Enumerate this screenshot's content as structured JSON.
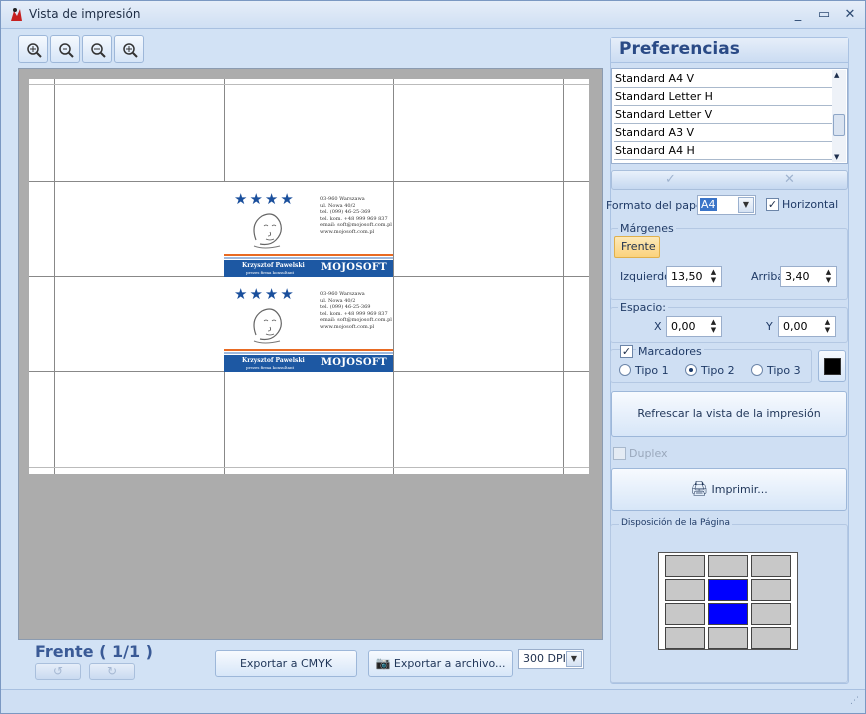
{
  "window": {
    "title": "Vista de impresión"
  },
  "toolbar": {
    "icons": [
      "zoom-fit-icon",
      "zoom-in-icon",
      "zoom-out-icon",
      "zoom-magnify-icon"
    ]
  },
  "preview": {
    "cards": [
      {
        "stars": "★★★★",
        "address": [
          "03-960 Warszawa",
          "ul. Nowa 40/2",
          "tel. (099) 46-25-369",
          "tel. kom. +48 999 969 837",
          "email: soft@mojosoft.com.pl",
          "www.mojosoft.com.pl"
        ],
        "name": "Krzysztof Pawelski",
        "job_title": "prezes firma konsultant",
        "brand": "MOJOSOFT"
      },
      {
        "stars": "★★★★",
        "address": [
          "03-960 Warszawa",
          "ul. Nowa 40/2",
          "tel. (099) 46-25-369",
          "tel. kom. +48 999 969 837",
          "email: soft@mojosoft.com.pl",
          "www.mojosoft.com.pl"
        ],
        "name": "Krzysztof Pawelski",
        "job_title": "prezes firma konsultant",
        "brand": "MOJOSOFT"
      }
    ]
  },
  "bottom": {
    "side_label": "Frente ( 1/1 )",
    "export_cmyk": "Exportar a CMYK",
    "export_file": "Exportar a archivo...",
    "dpi": "300 DPI"
  },
  "panel": {
    "title": "Preferencias",
    "formats": [
      "Standard A4 V",
      "Standard Letter H",
      "Standard Letter V",
      "Standard A3 V",
      "Standard A4 H"
    ],
    "ok": "✓",
    "cancel": "✕",
    "paper_label": "Formato del papel",
    "paper_value": "A4",
    "horizontal_label": "Horizontal",
    "horizontal_checked": true,
    "margins_title": "Márgenes",
    "margins_tab": "Frente",
    "left_label": "Izquierdo",
    "left_value": "13,50",
    "top_label": "Arriba",
    "top_value": "3,40",
    "space_title": "Espacio:",
    "x_label": "X",
    "x_value": "0,00",
    "y_label": "Y",
    "y_value": "0,00",
    "markers_label": "Marcadores",
    "markers_checked": true,
    "type1": "Tipo 1",
    "type2": "Tipo 2",
    "type3": "Tipo 3",
    "marker_color": "#000000",
    "refresh": "Refrescar la vista de la impresión",
    "duplex": "Duplex",
    "print": "Imprimir...",
    "layout_title": "Disposición de la Página",
    "layout_selected": [
      [
        1,
        1
      ],
      [
        2,
        1
      ]
    ]
  }
}
